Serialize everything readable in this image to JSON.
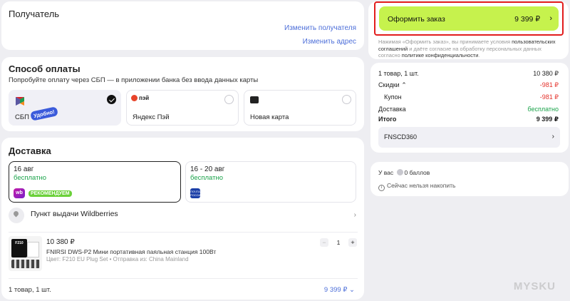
{
  "recipient": {
    "title": "Получатель",
    "change_recipient": "Изменить получателя",
    "change_address": "Изменить адрес"
  },
  "payment": {
    "title": "Способ оплаты",
    "subtitle": "Попробуйте оплату через СБП — в приложении банка без ввода данных карты",
    "options": [
      {
        "label": "СБП",
        "badge": "Удобно!",
        "selected": true,
        "icon": "sbp-logo"
      },
      {
        "label": "Яндекс Пэй",
        "logo_text": "пэй",
        "selected": false,
        "icon": "yandex-pay-logo"
      },
      {
        "label": "Новая карта",
        "selected": false,
        "icon": "card-add-icon"
      }
    ]
  },
  "delivery": {
    "title": "Доставка",
    "options": [
      {
        "date": "16 авг",
        "price": "бесплатно",
        "logo": "wb",
        "badge": "РЕКОМЕНДУЕМ",
        "selected": true
      },
      {
        "date": "16 - 20 авг",
        "price": "бесплатно",
        "logo": "ПОЧТА РОССИИ",
        "selected": false
      }
    ],
    "pickup": "Пункт выдачи Wildberries",
    "product": {
      "price": "10 380 ₽",
      "name": "FNIRSI DWS-P2 Мини портативная паяльная станция 100Вт",
      "meta": "Цвет: F210 EU Plug Set • Отправка из: China Mainland",
      "image_text": "F210",
      "quantity": "1"
    },
    "footer_count": "1 товар, 1 шт.",
    "footer_total": "9 399 ₽"
  },
  "order": {
    "button_label": "Оформить заказ",
    "button_sum": "9 399 ₽",
    "legal_1": "Нажимая «Оформить заказ», вы принимаете условия ",
    "legal_link_1": "пользовательских соглашений",
    "legal_2": " и даёте согласие на обработку персональных данных согласно ",
    "legal_link_2": "политике конфиденциальности",
    "legal_3": "."
  },
  "summary": {
    "items_label": "1 товар, 1 шт.",
    "items_value": "10 380 ₽",
    "discounts_label": "Скидки",
    "discounts_value": "-981 ₽",
    "coupon_label": "Купон",
    "coupon_value": "-981 ₽",
    "delivery_label": "Доставка",
    "delivery_value": "бесплатно",
    "total_label": "Итого",
    "total_value": "9 399 ₽",
    "promo_code": "FNSCD360"
  },
  "bonus": {
    "prefix": "У вас",
    "points": "0 баллов",
    "note": "Сейчас нельзя накопить"
  },
  "watermark": "MYSKU",
  "colors": {
    "accent_green": "#c6f24d",
    "highlight_red": "#e21c1c",
    "link_blue": "#4d6fd9",
    "discount_red": "#e4322b",
    "free_green": "#1aa34a"
  }
}
